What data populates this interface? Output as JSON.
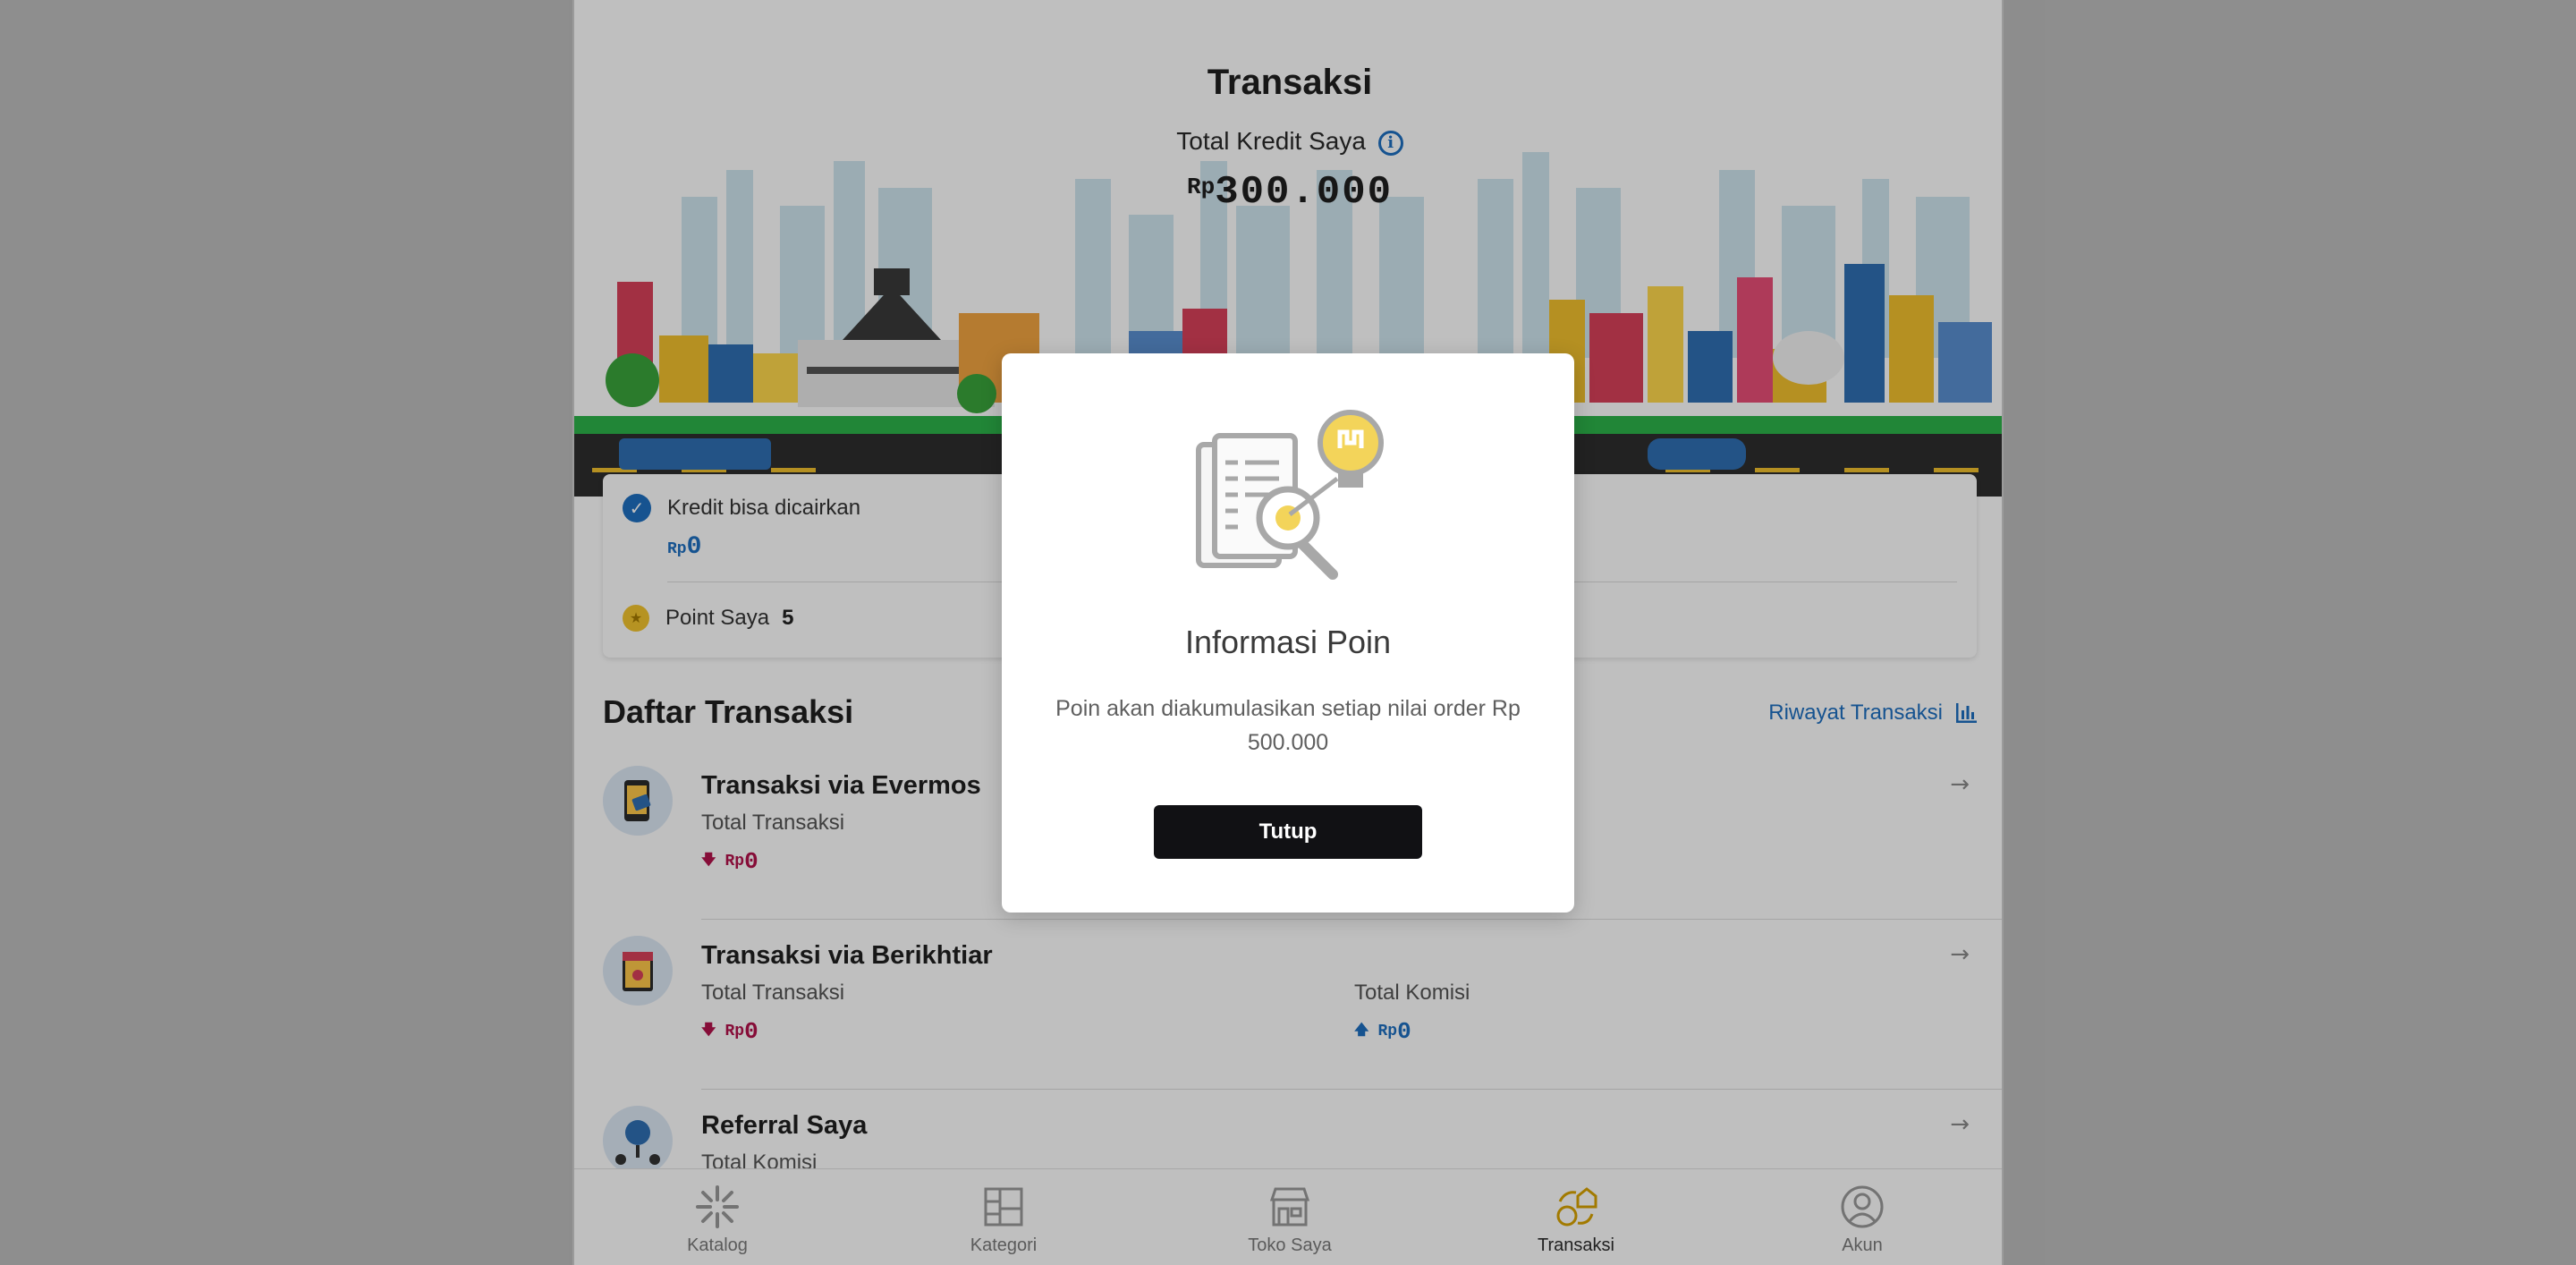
{
  "header": {
    "title": "Transaksi",
    "credit_label": "Total Kredit Saya",
    "credit_currency": "Rp",
    "credit_value": "300.000"
  },
  "credit_card": {
    "withdrawable_label": "Kredit bisa dicairkan",
    "withdrawable_currency": "Rp",
    "withdrawable_value": "0",
    "points_label": "Point Saya",
    "points_value": "5"
  },
  "transactions": {
    "title": "Daftar Transaksi",
    "history_link": "Riwayat Transaksi",
    "items": [
      {
        "name": "Transaksi via Evermos",
        "total_label": "Total Transaksi",
        "total_currency": "Rp",
        "total_value": "0"
      },
      {
        "name": "Transaksi via Berikhtiar",
        "total_label": "Total Transaksi",
        "total_currency": "Rp",
        "total_value": "0",
        "commission_label": "Total Komisi",
        "commission_currency": "Rp",
        "commission_value": "0"
      },
      {
        "name": "Referral Saya",
        "commission_label": "Total Komisi"
      }
    ]
  },
  "nav": {
    "items": [
      {
        "label": "Katalog",
        "icon": "spark-icon"
      },
      {
        "label": "Kategori",
        "icon": "grid-icon"
      },
      {
        "label": "Toko Saya",
        "icon": "store-icon"
      },
      {
        "label": "Transaksi",
        "icon": "transaction-icon",
        "active": true
      },
      {
        "label": "Akun",
        "icon": "user-icon"
      }
    ]
  },
  "modal": {
    "title": "Informasi Poin",
    "text": "Poin akan diakumulasikan setiap nilai order Rp 500.000",
    "button": "Tutup"
  },
  "colors": {
    "accent": "#1e6fc0",
    "negative": "#b3124b",
    "button": "#111114",
    "overlay": "rgba(0,0,0,0.25)"
  }
}
